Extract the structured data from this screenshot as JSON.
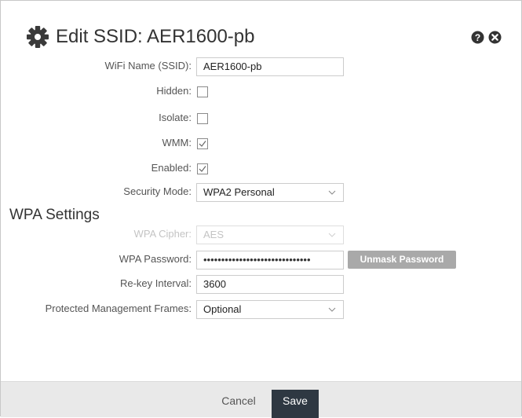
{
  "dialog": {
    "title": "Edit SSID: AER1600-pb",
    "title_icon": "gear-icon",
    "help_icon": "question-circle-icon",
    "close_icon": "close-circle-icon"
  },
  "fields": {
    "wifi_name_label": "WiFi Name (SSID):",
    "wifi_name_value": "AER1600-pb",
    "hidden_label": "Hidden:",
    "hidden_checked": false,
    "isolate_label": "Isolate:",
    "isolate_checked": false,
    "wmm_label": "WMM:",
    "wmm_checked": true,
    "enabled_label": "Enabled:",
    "enabled_checked": true,
    "security_mode_label": "Security Mode:",
    "security_mode_value": "WPA2 Personal"
  },
  "wpa": {
    "section_title": "WPA Settings",
    "cipher_label": "WPA Cipher:",
    "cipher_value": "AES",
    "password_label": "WPA Password:",
    "password_masked": "••••••••••••••••••••••••••••••",
    "unmask_label": "Unmask Password",
    "rekey_label": "Re-key Interval:",
    "rekey_value": "3600",
    "pmf_label": "Protected Management Frames:",
    "pmf_value": "Optional"
  },
  "footer": {
    "cancel_label": "Cancel",
    "save_label": "Save"
  },
  "colors": {
    "save_button_bg": "#2e3842",
    "unmask_button_bg": "#a9a9a9",
    "footer_bg": "#e9e9e9"
  }
}
